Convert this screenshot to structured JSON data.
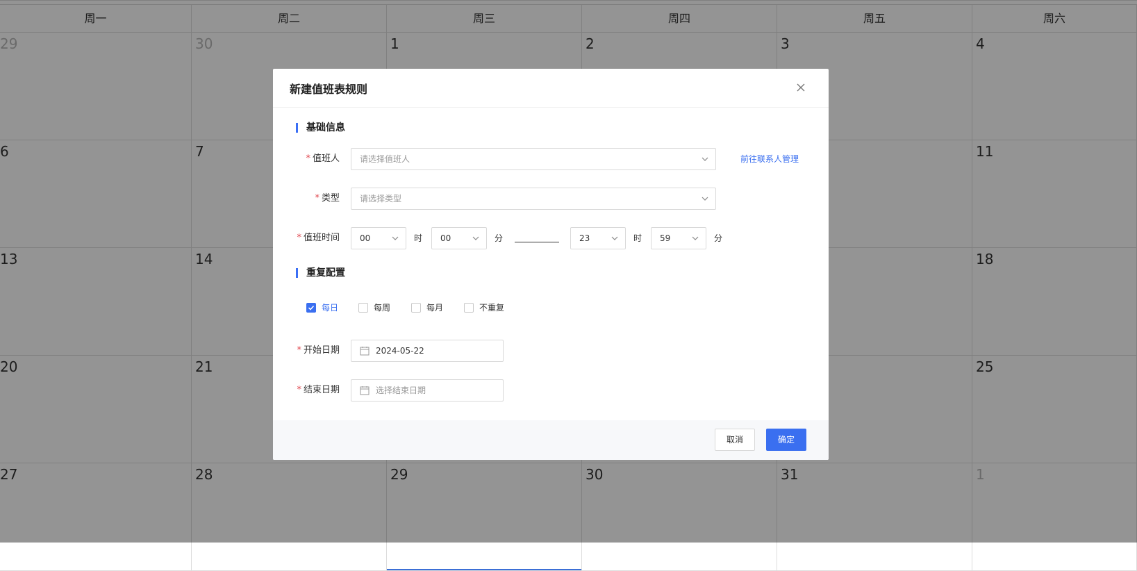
{
  "calendar": {
    "weekdays": [
      "周一",
      "周二",
      "周三",
      "周四",
      "周五",
      "周六"
    ],
    "weeks": [
      [
        {
          "d": "29",
          "other": true
        },
        {
          "d": "30",
          "other": true
        },
        {
          "d": "1"
        },
        {
          "d": "2"
        },
        {
          "d": "3"
        },
        {
          "d": "4"
        }
      ],
      [
        {
          "d": "6"
        },
        {
          "d": "7"
        },
        {
          "d": ""
        },
        {
          "d": ""
        },
        {
          "d": ""
        },
        {
          "d": "11"
        }
      ],
      [
        {
          "d": "13"
        },
        {
          "d": "14"
        },
        {
          "d": ""
        },
        {
          "d": ""
        },
        {
          "d": ""
        },
        {
          "d": "18"
        }
      ],
      [
        {
          "d": "20"
        },
        {
          "d": "21"
        },
        {
          "d": ""
        },
        {
          "d": ""
        },
        {
          "d": ""
        },
        {
          "d": "25"
        }
      ],
      [
        {
          "d": "27"
        },
        {
          "d": "28"
        },
        {
          "d": "29",
          "today": true
        },
        {
          "d": "30"
        },
        {
          "d": "31"
        },
        {
          "d": "1",
          "other": true
        }
      ]
    ]
  },
  "dialog": {
    "title": "新建值班表规则",
    "sections": {
      "basic": "基础信息",
      "repeat": "重复配置"
    },
    "fields": {
      "person_label": "值班人",
      "person_placeholder": "请选择值班人",
      "contact_link": "前往联系人管理",
      "type_label": "类型",
      "type_placeholder": "请选择类型",
      "time_label": "值班时间",
      "start_hour": "00",
      "start_minute": "00",
      "end_hour": "23",
      "end_minute": "59",
      "hour_unit": "时",
      "minute_unit": "分",
      "start_date_label": "开始日期",
      "start_date_value": "2024-05-22",
      "end_date_label": "结束日期",
      "end_date_placeholder": "选择结束日期",
      "required_mark": "*"
    },
    "repeat_options": [
      {
        "label": "每日",
        "checked": true
      },
      {
        "label": "每周",
        "checked": false
      },
      {
        "label": "每月",
        "checked": false
      },
      {
        "label": "不重复",
        "checked": false
      }
    ],
    "buttons": {
      "cancel": "取消",
      "ok": "确定"
    }
  },
  "colors": {
    "accent": "#3a6ff0",
    "required": "#e0464e",
    "overlay": "rgba(0,0,0,0.42)"
  },
  "icons": {
    "close": "close-icon",
    "dropdown": "chevron-down-icon",
    "date": "calendar-icon",
    "check": "check-icon"
  }
}
